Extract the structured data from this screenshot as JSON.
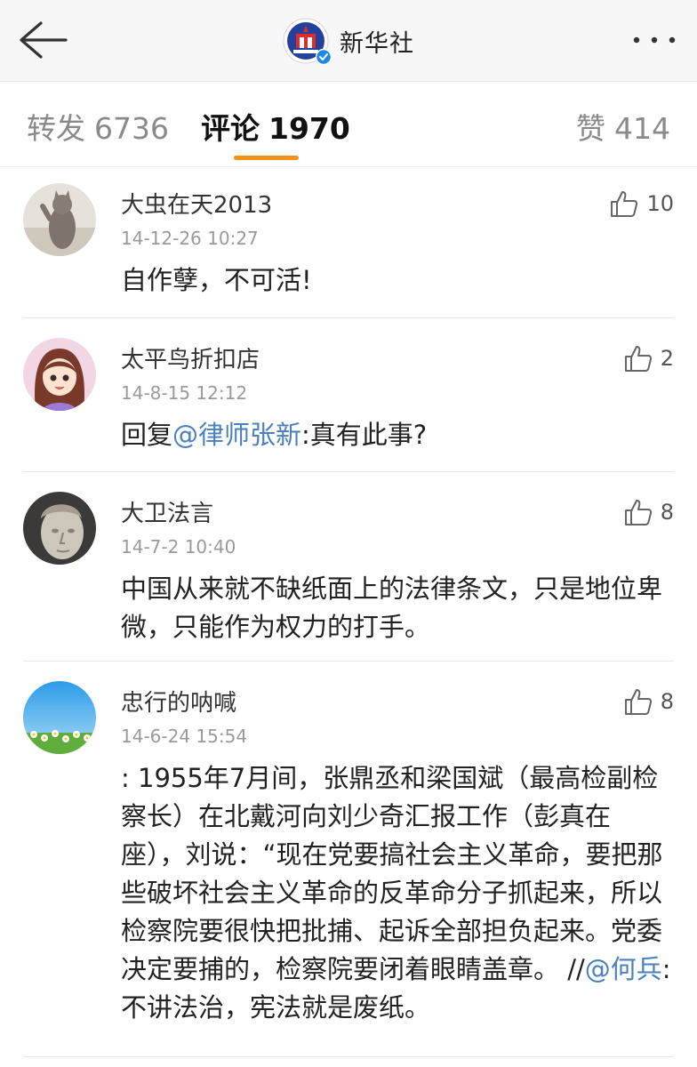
{
  "header": {
    "title": "新华社",
    "back_icon": "arrow-left-icon",
    "more_icon": "more-horizontal-icon",
    "verified_color": "#1e88e5"
  },
  "tabs": [
    {
      "label": "转发",
      "count": "6736",
      "active": false
    },
    {
      "label": "评论",
      "count": "1970",
      "active": true
    },
    {
      "label": "赞",
      "count": "414",
      "active": false
    }
  ],
  "accent_color": "#f29318",
  "mention_color": "#4a7fc0",
  "comments": [
    {
      "user": "大虫在天2013",
      "time": "14-12-26 10:27",
      "likes": "10",
      "text": "自作孽，不可活!"
    },
    {
      "user": "太平鸟折扣店",
      "time": "14-8-15 12:12",
      "likes": "2",
      "text_prefix": "回复",
      "mention": "@律师张新",
      "text_suffix": ":真有此事?"
    },
    {
      "user": "大卫法言",
      "time": "14-7-2 10:40",
      "likes": "8",
      "text": "中国从来就不缺纸面上的法律条文，只是地位卑微，只能作为权力的打手。"
    },
    {
      "user": "忠行的呐喊",
      "time": "14-6-24 15:54",
      "likes": "8",
      "text_prefix": ": 1955年7月间，张鼎丞和梁国斌（最高检副检察长）在北戴河向刘少奇汇报工作（彭真在座），刘说：“现在党要搞社会主义革命，要把那些破坏社会主义革命的反革命分子抓起来，所以检察院要很快把批捕、起诉全部担负起来。党委决定要捕的，检察院要闭着眼睛盖章。 //",
      "mention": "@何兵",
      "text_suffix": ": 不讲法治，宪法就是废纸。"
    }
  ]
}
